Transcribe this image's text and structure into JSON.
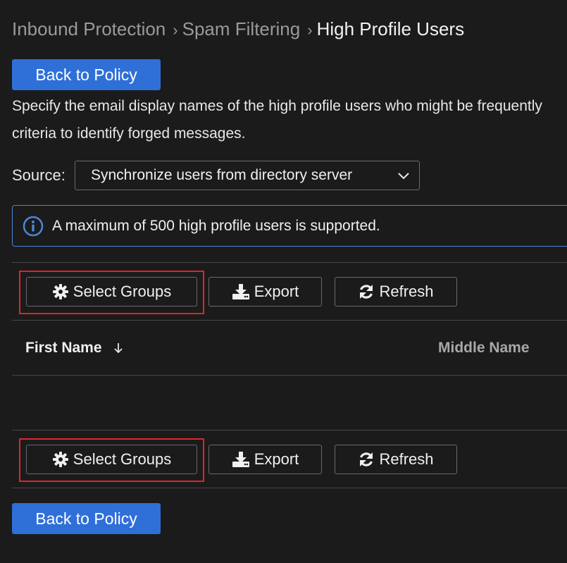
{
  "breadcrumb": {
    "items": [
      "Inbound Protection",
      "Spam Filtering"
    ],
    "separator": "›",
    "current": "High Profile Users"
  },
  "back_button_label": "Back to Policy",
  "description": {
    "line1": "Specify the email display names of the high profile users who might be frequently",
    "line2": "criteria to identify forged messages."
  },
  "source": {
    "label": "Source:",
    "selected": "Synchronize users from directory server"
  },
  "info": {
    "text": "A maximum of 500 high profile users is supported."
  },
  "toolbar": {
    "select_groups": "Select Groups",
    "export": "Export",
    "refresh": "Refresh"
  },
  "table": {
    "columns": [
      "First Name",
      "Middle Name"
    ],
    "sort_indicator": "descending",
    "rows": []
  },
  "colors": {
    "primary": "#2f6fd8",
    "info_border": "#4b86d8",
    "highlight": "#e0242b",
    "background": "#1b1b1b"
  }
}
